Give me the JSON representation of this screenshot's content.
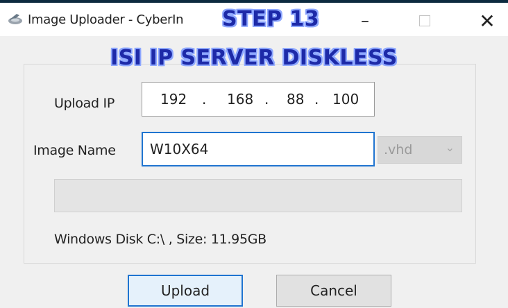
{
  "window": {
    "title": "Image Uploader - CyberIn",
    "step_overlay": "STEP 13",
    "banner": "ISI IP SERVER DISKLESS",
    "controls": {
      "minimize": "–",
      "close": "✕"
    },
    "icons": {
      "app": "app-icon",
      "maximize": "maximize-icon"
    },
    "accent_color": "#1f74d0",
    "overlay_color": "#1d2aa8"
  },
  "form": {
    "upload_ip_label": "Upload IP",
    "ip": {
      "seg1": "192",
      "seg2": "168",
      "seg3": "88",
      "seg4": "100",
      "dot": "."
    },
    "image_name_label": "Image Name",
    "image_name_value": "W10X64",
    "extension": {
      "selected": ".vhd",
      "chevron": "⌄"
    },
    "progress_percent": 0,
    "status_text": "Windows Disk C:\\ , Size: 11.95GB"
  },
  "buttons": {
    "upload": "Upload",
    "cancel": "Cancel"
  }
}
